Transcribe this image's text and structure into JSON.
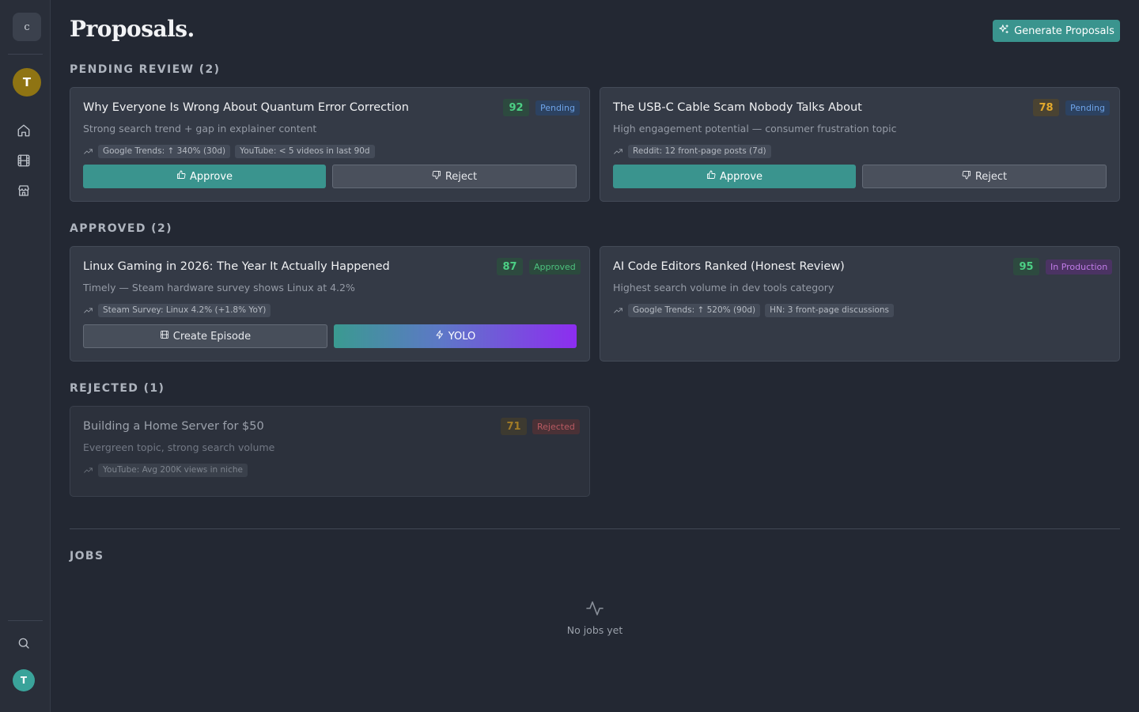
{
  "sidebar": {
    "logo_letter": "c",
    "workspace_initial": "T",
    "user_initial": "T",
    "nav": [
      {
        "icon": "home-icon"
      },
      {
        "icon": "film-icon"
      },
      {
        "icon": "store-icon"
      }
    ]
  },
  "header": {
    "title": "Proposals.",
    "generate_label": "Generate Proposals"
  },
  "sections": {
    "pending": "PENDING REVIEW (2)",
    "approved": "APPROVED (2)",
    "rejected": "REJECTED (1)",
    "jobs": "JOBS"
  },
  "cards": [
    {
      "title": "Why Everyone Is Wrong About Quantum Error Correction",
      "score": "92",
      "status": "Pending",
      "description": "Strong search trend + gap in explainer content",
      "signals": [
        "Google Trends: ↑ 340% (30d)",
        "YouTube: < 5 videos in last 90d"
      ],
      "approve_label": "Approve",
      "reject_label": "Reject"
    },
    {
      "title": "The USB-C Cable Scam Nobody Talks About",
      "score": "78",
      "status": "Pending",
      "description": "High engagement potential — consumer frustration topic",
      "signals": [
        "Reddit: 12 front-page posts (7d)"
      ],
      "approve_label": "Approve",
      "reject_label": "Reject"
    },
    {
      "title": "Linux Gaming in 2026: The Year It Actually Happened",
      "score": "87",
      "status": "Approved",
      "description": "Timely — Steam hardware survey shows Linux at 4.2%",
      "signals": [
        "Steam Survey: Linux 4.2% (+1.8% YoY)"
      ],
      "create_label": "Create Episode",
      "yolo_label": "YOLO"
    },
    {
      "title": "AI Code Editors Ranked (Honest Review)",
      "score": "95",
      "status": "In Production",
      "description": "Highest search volume in dev tools category",
      "signals": [
        "Google Trends: ↑ 520% (90d)",
        "HN: 3 front-page discussions"
      ]
    },
    {
      "title": "Building a Home Server for $50",
      "score": "71",
      "status": "Rejected",
      "description": "Evergreen topic, strong search volume",
      "signals": [
        "YouTube: Avg 200K views in niche"
      ]
    }
  ],
  "jobs": {
    "empty_text": "No jobs yet"
  },
  "colors": {
    "accent": "#3a948e",
    "pending": "#6ea3e8",
    "approved": "#4dc27e",
    "production": "#c07ce8",
    "rejected": "#b85a62"
  }
}
